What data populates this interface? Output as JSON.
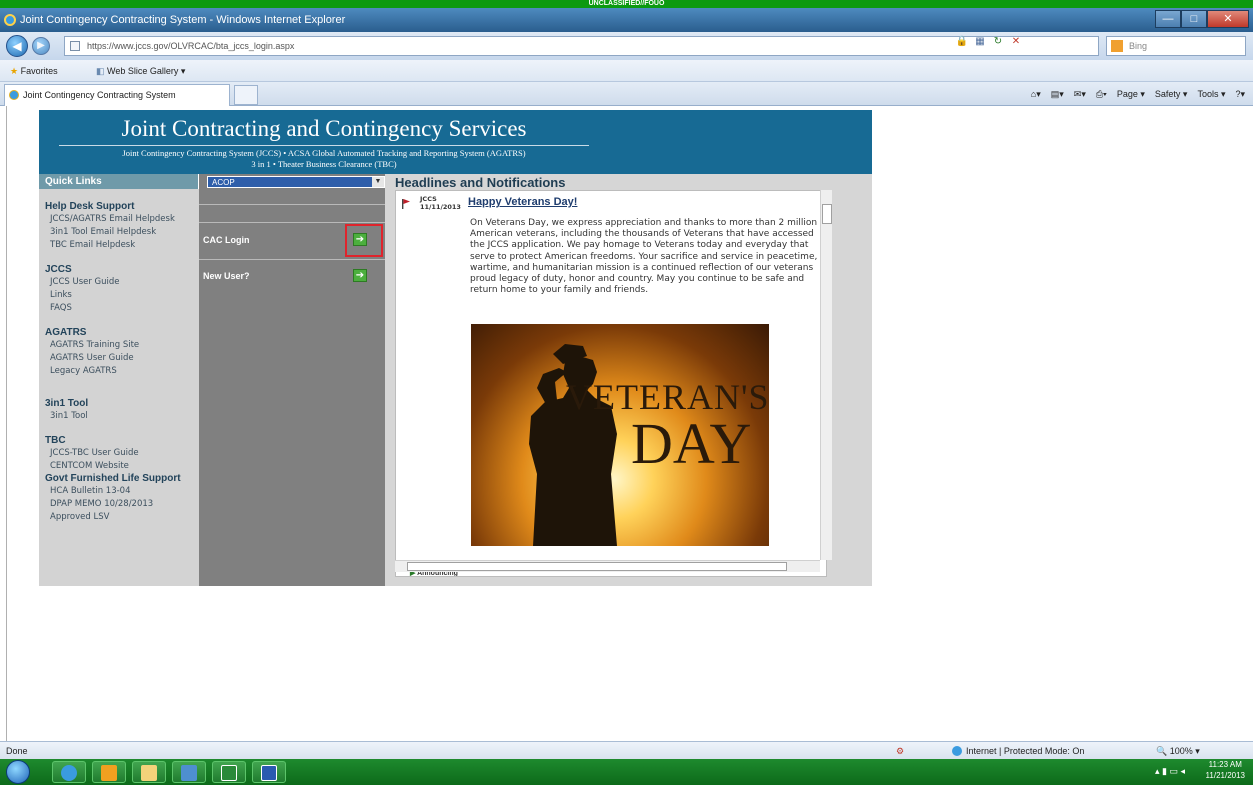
{
  "classification": "UNCLASSIFIED//FOUO",
  "window": {
    "title": "Joint Contingency Contracting System - Windows Internet Explorer",
    "controls": [
      "—",
      "□",
      "✕"
    ]
  },
  "address_bar": {
    "url": "https://www.jccs.gov/OLVRCAC/bta_jccs_login.aspx",
    "search_placeholder": "Bing"
  },
  "favorites_bar": {
    "favorites_label": "Favorites",
    "web_slice_label": "Web Slice Gallery ▾"
  },
  "tab": {
    "label": "Joint Contingency Contracting System"
  },
  "command_bar": {
    "page": "Page ▾",
    "safety": "Safety ▾",
    "tools": "Tools ▾",
    "help": "?▾"
  },
  "site": {
    "title": "Joint Contracting and Contingency Services",
    "subtitle_line1": "Joint Contingency Contracting System (JCCS)  •  ACSA Global Automated Tracking and Reporting System (AGATRS)",
    "subtitle_line2": "3 in 1  •  Theater Business Clearance  (TBC)"
  },
  "quick_links": {
    "header": "Quick Links",
    "sections": [
      {
        "title": "Help Desk Support",
        "links": [
          "JCCS/AGATRS Email Helpdesk",
          "3in1 Tool Email Helpdesk",
          "TBC Email Helpdesk"
        ]
      },
      {
        "title": "JCCS",
        "links": [
          "JCCS User Guide",
          "Links",
          "FAQS"
        ]
      },
      {
        "title": "AGATRS",
        "links": [
          "AGATRS Training Site",
          "AGATRS User Guide",
          "Legacy AGATRS"
        ]
      },
      {
        "title": "3in1 Tool",
        "links": [
          "3in1 Tool"
        ]
      },
      {
        "title": "TBC",
        "links": [
          "JCCS-TBC User Guide",
          "CENTCOM Website"
        ]
      },
      {
        "title": "Govt Furnished Life Support",
        "links": [
          "HCA Bulletin 13-04",
          "DPAP MEMO 10/28/2013",
          "Approved LSV"
        ]
      }
    ]
  },
  "login_panel": {
    "select_value": "ACOP",
    "cac_login_label": "CAC Login",
    "new_user_label": "New User?"
  },
  "news": {
    "header": "Headlines and Notifications",
    "source": "JCCS",
    "date": "11/11/2013",
    "title": "Happy Veterans Day!",
    "body": "On Veterans Day, we express appreciation and thanks to more than 2 million American veterans, including the thousands of Veterans that have accessed the JCCS application. We pay homage to Veterans today and everyday that serve to protect American freedoms. Your sacrifice and service in peacetime, wartime, and humanitarian mission is a continued reflection of our veterans proud legacy of duty, honor and country. May you continue to be safe and return home to your family and friends.",
    "image_text_line1": "VETERAN'S",
    "image_text_line2": "DAY",
    "next_item": "Announcing"
  },
  "status_bar": {
    "left": "Done",
    "zone": "Internet | Protected Mode: On",
    "zoom": "100%"
  },
  "taskbar": {
    "time": "11:23 AM",
    "date": "11/21/2013"
  },
  "colors": {
    "banner": "#176a94",
    "highlight_box": "#e0242c",
    "go_button": "#4caf3e",
    "classification_bar": "#0c9a10"
  }
}
